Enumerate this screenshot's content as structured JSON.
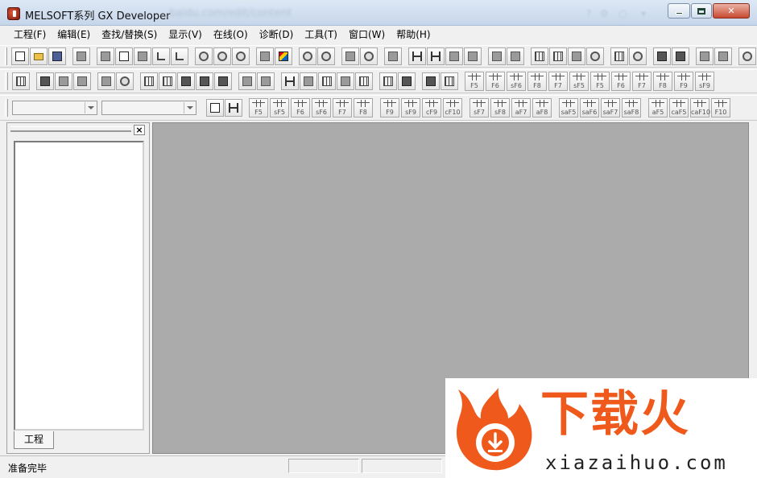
{
  "window": {
    "title": "MELSOFT系列 GX Developer",
    "blurred_url": "...baidu.com/edit/content"
  },
  "menu": [
    "工程(F)",
    "编辑(E)",
    "查找/替换(S)",
    "显示(V)",
    "在线(O)",
    "诊断(D)",
    "工具(T)",
    "窗口(W)",
    "帮助(H)"
  ],
  "toolbar2_keys": [
    "F5",
    "F6",
    "sF6",
    "F8",
    "F7",
    "sF5",
    "F5",
    "F6",
    "F7",
    "F8",
    "F9",
    "sF9"
  ],
  "toolbar3_keys": [
    "F5",
    "sF5",
    "F6",
    "sF6",
    "F7",
    "F8",
    "F9",
    "sF9",
    "cF9",
    "cF10",
    "sF7",
    "sF8",
    "aF7",
    "aF8",
    "saF5",
    "saF6",
    "saF7",
    "saF8",
    "aF5",
    "caF5",
    "caF10",
    "F10"
  ],
  "project_pane": {
    "tab_label": "工程"
  },
  "status": {
    "text": "准备完毕"
  },
  "watermark": {
    "cn": "下载火",
    "en": "xiazaihuo.com"
  },
  "colors": {
    "workarea": "#ababab",
    "watermark_orange": "#ef5a1c"
  }
}
